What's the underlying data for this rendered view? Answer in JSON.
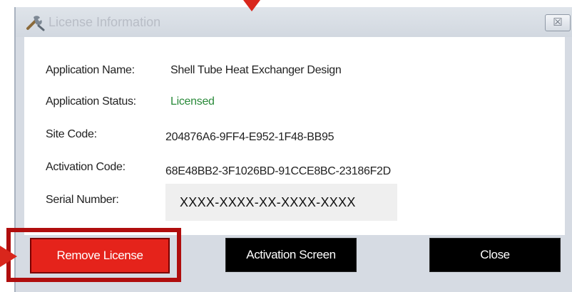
{
  "window": {
    "title": "License Information",
    "close_glyph": "☒"
  },
  "fields": {
    "app_name_label": "Application Name:",
    "app_name_value": "Shell  Tube Heat Exchanger Design",
    "app_status_label": "Application Status:",
    "app_status_value": "Licensed",
    "site_code_label": "Site Code:",
    "site_code_value": "204876A6-9FF4-E952-1F48-BB95",
    "activation_code_label": "Activation Code:",
    "activation_code_value": "68E48BB2-3F1026BD-91CCE8BC-23186F2D",
    "serial_label": "Serial Number:",
    "serial_value": "XXXX-XXXX-XX-XXXX-XXXX"
  },
  "buttons": {
    "remove": "Remove License",
    "activation": "Activation Screen",
    "close": "Close"
  },
  "colors": {
    "status_licensed": "#2a8a3a",
    "remove_button": "#e5231b",
    "highlight": "#b00d0d",
    "annotation_arrow": "#d9261c"
  }
}
